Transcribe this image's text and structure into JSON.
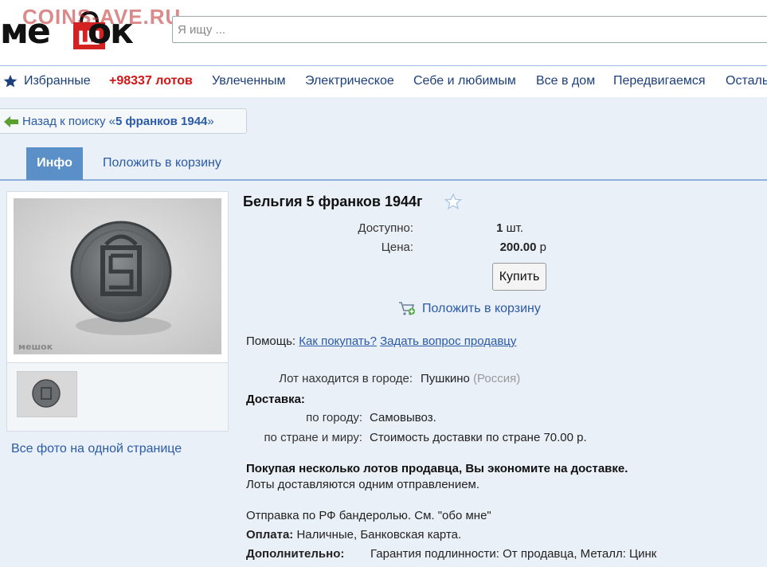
{
  "site": {
    "logo_text": "МЕШОК",
    "watermark": "COINS-AVE.RU"
  },
  "search": {
    "placeholder": "Я ищу ..."
  },
  "nav": {
    "items": [
      "Избранные",
      "+98337 лотов",
      "Увлеченным",
      "Электрическое",
      "Себе и любимым",
      "Все в дом",
      "Передвигаемся",
      "Осталь"
    ]
  },
  "back": {
    "prefix": "Назад к поиску «",
    "query": "5 франков 1944",
    "suffix": "»"
  },
  "tabs": {
    "info": "Инфо",
    "add_to_cart": "Положить в корзину"
  },
  "gallery": {
    "photo_watermark": "мешок",
    "all_photos": "Все фото на одной странице"
  },
  "lot": {
    "title": "Бельгия 5 франков 1944г",
    "available_label": "Доступно:",
    "available_value": "1",
    "available_unit": "шт.",
    "price_label": "Цена:",
    "price_value": "200.00",
    "price_unit": "р",
    "buy_button": "Купить",
    "cart_link": "Положить в корзину",
    "help_label": "Помощь:",
    "help_link1": "Как покупать?",
    "help_link2": "Задать вопрос продавцу",
    "city_label": "Лот находится в городе:",
    "city": "Пушкино",
    "country": "(Россия)",
    "delivery_label": "Доставка:",
    "delivery_city_label": "по городу:",
    "delivery_city_value": "Самовывоз.",
    "delivery_world_label": "по стране и миру:",
    "delivery_world_value": "Стоимость доставки по стране 70.00 р.",
    "savings_bold": "Покупая несколько лотов продавца, Вы экономите на доставке.",
    "savings_note": "Лоты доставляются одним отправлением.",
    "shipping_note": "Отправка по РФ бандеролью. См. \"обо мне\"",
    "payment_label": "Оплата:",
    "payment_value": "Наличные, Банковская карта.",
    "extra_label": "Дополнительно:",
    "extra_value": "Гарантия подлинности: От продавца, Металл: Цинк"
  },
  "colors": {
    "link": "#2a5aa8",
    "nav": "#1b3f7a",
    "hot": "#d41515",
    "tab_active": "#5b8fc8",
    "background": "#eaf0f7"
  },
  "icons": [
    "star-icon",
    "back-arrow-icon",
    "favorite-star-icon",
    "cart-add-icon",
    "shopping-bag-logo-icon"
  ]
}
